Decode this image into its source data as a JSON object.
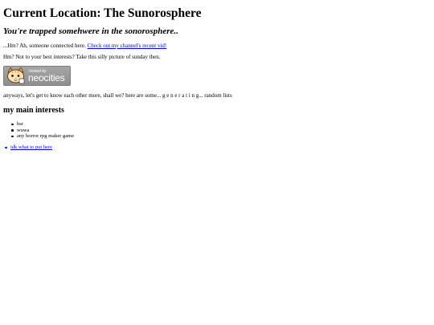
{
  "page": {
    "title": "Current Location: The Sunorosphere",
    "subtitle": "You're trapped somehwere in the sonorosphere..",
    "intro_text": "...Hm? Ah, someone connected here.",
    "intro_link": "Check out my channel's recent vid!",
    "interests_prompt": "Hm? Not to your best interests? Take this silly picture of sunday then.",
    "badge": {
      "hosted_by": "hosted by",
      "brand": "neocities",
      "icon": "neocities-cat-icon"
    },
    "lists_intro": "anyways, let's get to know each other more, shall we? here are some... g e n e r a t i n g... random lists",
    "interests_heading": "my main interests",
    "interests": [
      "hsr",
      "wuwa",
      "any horror rpg maker game"
    ],
    "links": [
      "idk what to put here"
    ]
  },
  "colors": {
    "link": "#0000ee",
    "background": "#ffffff",
    "text": "#000000",
    "badge_background": "#9a9a9a",
    "badge_icon_accent": "#f7a23a"
  }
}
